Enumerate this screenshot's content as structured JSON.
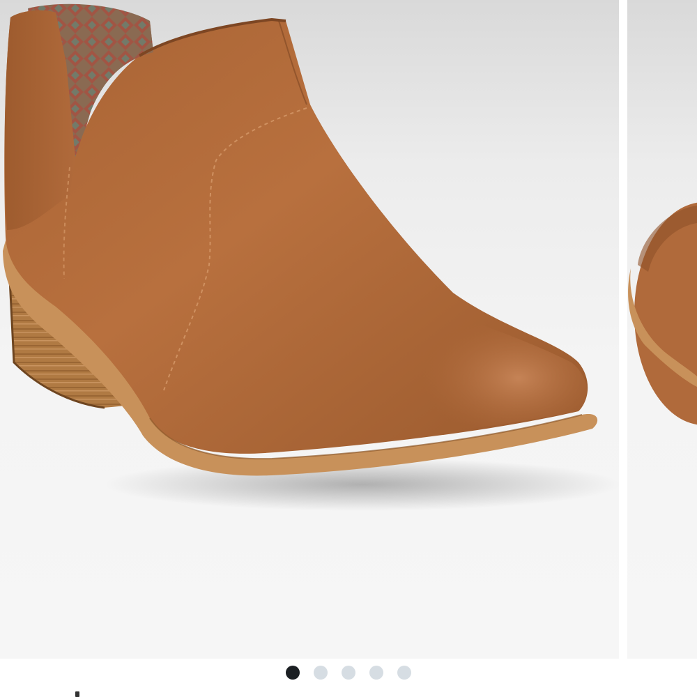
{
  "carousel": {
    "current_index": 1,
    "total_slides": 5,
    "slides": [
      {
        "subject": "ankle-bootie",
        "active": true
      },
      {
        "subject": "ankle-bootie",
        "active": false
      },
      {
        "subject": "ankle-bootie",
        "active": false
      },
      {
        "subject": "ankle-bootie",
        "active": false
      },
      {
        "subject": "ankle-bootie",
        "active": false
      }
    ]
  },
  "colors": {
    "leather": "#b06a3b",
    "leather_dark": "#8f5129",
    "heel_wood": "#a8743f",
    "sole_gum": "#c8915a",
    "dot_active": "#1b1f23",
    "dot_inactive": "#d6dde3",
    "backdrop": "#f4f4f4"
  }
}
